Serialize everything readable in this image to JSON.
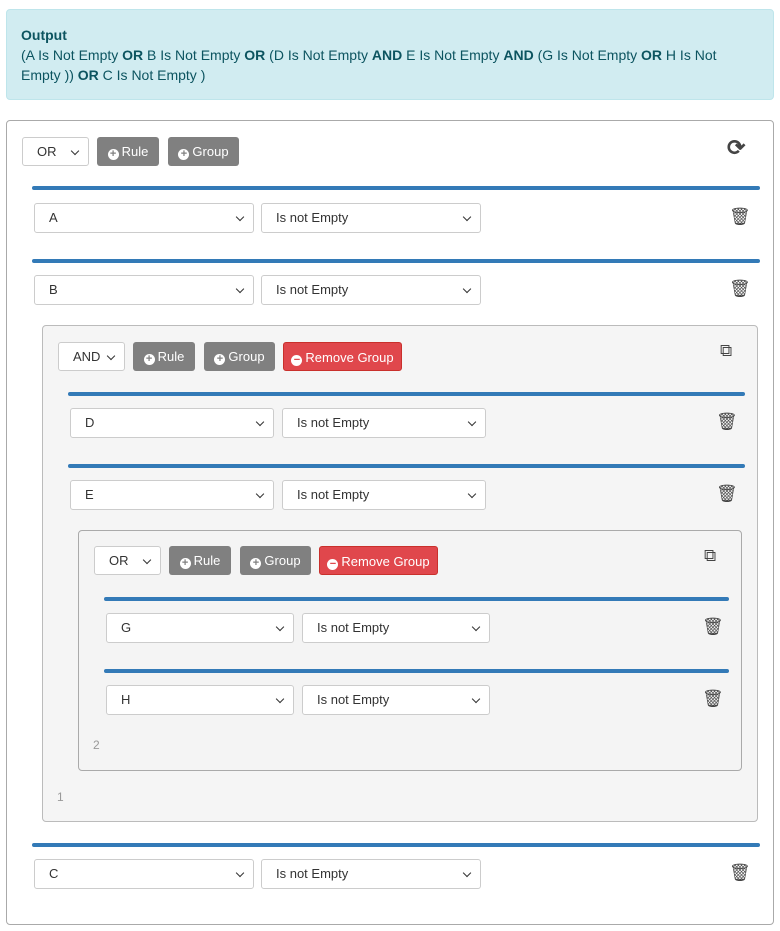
{
  "output": {
    "title": "Output",
    "parts": [
      "(A Is Not Empty ",
      "OR",
      " B Is Not Empty ",
      "OR",
      " (D Is Not Empty ",
      "AND",
      " E Is Not Empty ",
      "AND",
      " (G Is Not Empty ",
      "OR",
      " H Is Not Empty )) ",
      "OR",
      " C Is Not Empty )"
    ]
  },
  "root": {
    "condition": "OR",
    "add_rule": "Rule",
    "add_group": "Group",
    "icon": "refresh-icon",
    "rules": [
      {
        "field": "A",
        "operator": "Is not Empty"
      },
      {
        "field": "B",
        "operator": "Is not Empty"
      },
      {
        "field": "C",
        "operator": "Is not Empty"
      }
    ],
    "group1": {
      "condition": "AND",
      "add_rule": "Rule",
      "add_group": "Group",
      "remove_group": "Remove Group",
      "index": "1",
      "icon": "copy-icon",
      "rules": [
        {
          "field": "D",
          "operator": "Is not Empty"
        },
        {
          "field": "E",
          "operator": "Is not Empty"
        }
      ],
      "group2": {
        "condition": "OR",
        "add_rule": "Rule",
        "add_group": "Group",
        "remove_group": "Remove Group",
        "index": "2",
        "icon": "copy-icon",
        "rules": [
          {
            "field": "G",
            "operator": "Is not Empty"
          },
          {
            "field": "H",
            "operator": "Is not Empty"
          }
        ]
      }
    }
  },
  "colors": {
    "accent": "#337ab7",
    "danger": "#e0474c",
    "neutral": "#808080"
  }
}
